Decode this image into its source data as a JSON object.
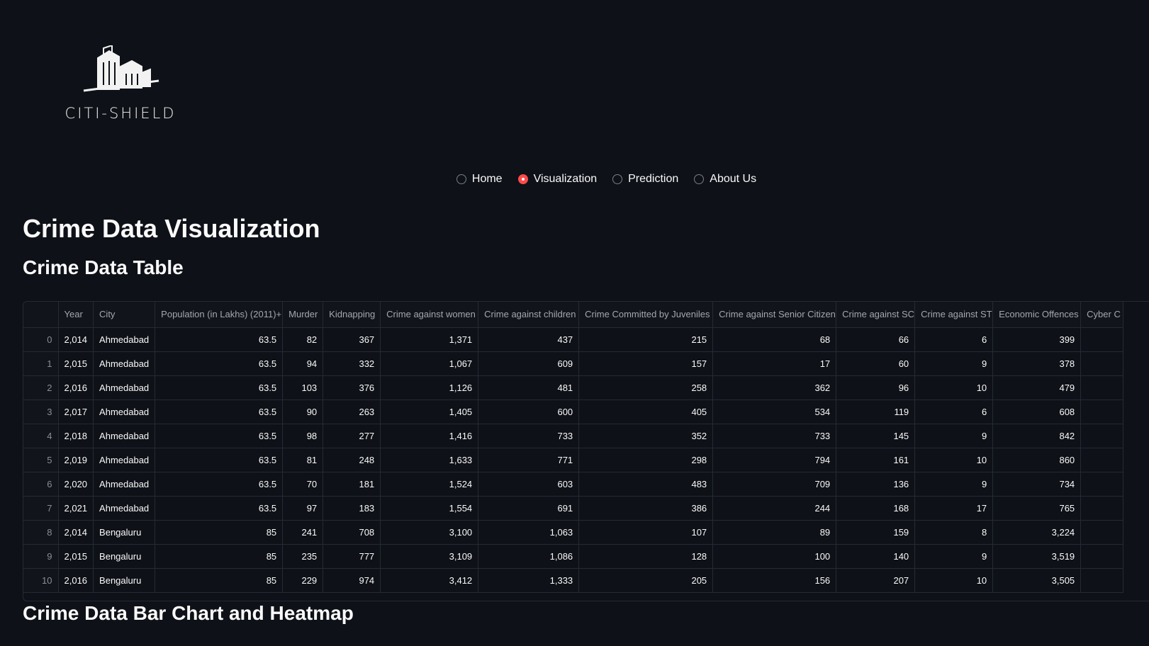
{
  "brand": {
    "name": "CITI-SHIELD"
  },
  "nav": {
    "items": [
      {
        "label": "Home",
        "selected": false
      },
      {
        "label": "Visualization",
        "selected": true
      },
      {
        "label": "Prediction",
        "selected": false
      },
      {
        "label": "About Us",
        "selected": false
      }
    ],
    "accent_color": "#ff4b4b"
  },
  "page": {
    "title": "Crime Data Visualization",
    "table_heading": "Crime Data Table",
    "chart_heading": "Crime Data Bar Chart and Heatmap"
  },
  "table": {
    "columns": [
      "",
      "Year",
      "City",
      "Population (in Lakhs) (2011)+",
      "Murder",
      "Kidnapping",
      "Crime against women",
      "Crime against children",
      "Crime Committed by Juveniles",
      "Crime against Senior Citizen",
      "Crime against SC",
      "Crime against ST",
      "Economic Offences",
      "Cyber C"
    ],
    "rows": [
      [
        "0",
        "2,014",
        "Ahmedabad",
        "63.5",
        "82",
        "367",
        "1,371",
        "437",
        "215",
        "68",
        "66",
        "6",
        "399",
        ""
      ],
      [
        "1",
        "2,015",
        "Ahmedabad",
        "63.5",
        "94",
        "332",
        "1,067",
        "609",
        "157",
        "17",
        "60",
        "9",
        "378",
        ""
      ],
      [
        "2",
        "2,016",
        "Ahmedabad",
        "63.5",
        "103",
        "376",
        "1,126",
        "481",
        "258",
        "362",
        "96",
        "10",
        "479",
        ""
      ],
      [
        "3",
        "2,017",
        "Ahmedabad",
        "63.5",
        "90",
        "263",
        "1,405",
        "600",
        "405",
        "534",
        "119",
        "6",
        "608",
        ""
      ],
      [
        "4",
        "2,018",
        "Ahmedabad",
        "63.5",
        "98",
        "277",
        "1,416",
        "733",
        "352",
        "733",
        "145",
        "9",
        "842",
        ""
      ],
      [
        "5",
        "2,019",
        "Ahmedabad",
        "63.5",
        "81",
        "248",
        "1,633",
        "771",
        "298",
        "794",
        "161",
        "10",
        "860",
        ""
      ],
      [
        "6",
        "2,020",
        "Ahmedabad",
        "63.5",
        "70",
        "181",
        "1,524",
        "603",
        "483",
        "709",
        "136",
        "9",
        "734",
        ""
      ],
      [
        "7",
        "2,021",
        "Ahmedabad",
        "63.5",
        "97",
        "183",
        "1,554",
        "691",
        "386",
        "244",
        "168",
        "17",
        "765",
        ""
      ],
      [
        "8",
        "2,014",
        "Bengaluru",
        "85",
        "241",
        "708",
        "3,100",
        "1,063",
        "107",
        "89",
        "159",
        "8",
        "3,224",
        ""
      ],
      [
        "9",
        "2,015",
        "Bengaluru",
        "85",
        "235",
        "777",
        "3,109",
        "1,086",
        "128",
        "100",
        "140",
        "9",
        "3,519",
        ""
      ],
      [
        "10",
        "2,016",
        "Bengaluru",
        "85",
        "229",
        "974",
        "3,412",
        "1,333",
        "205",
        "156",
        "207",
        "10",
        "3,505",
        ""
      ]
    ]
  }
}
